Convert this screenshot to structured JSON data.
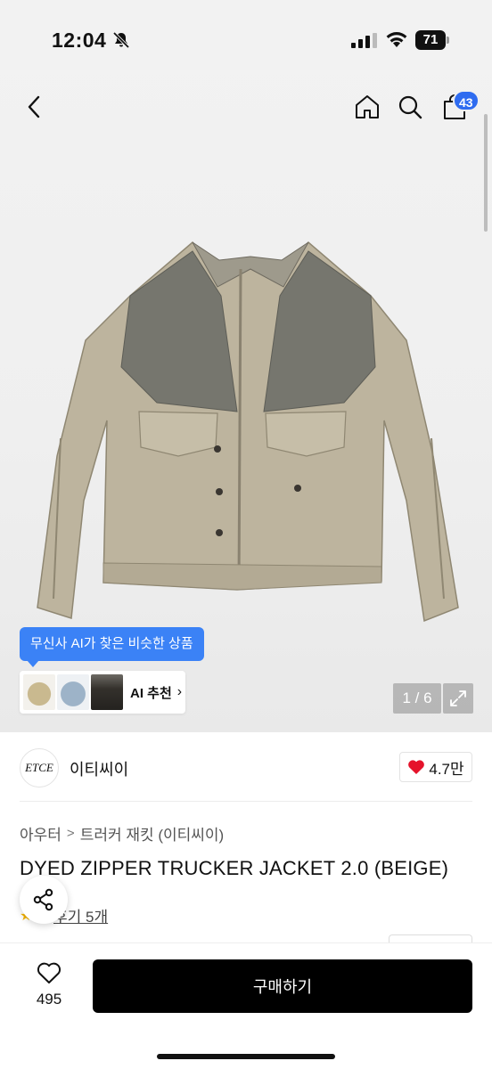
{
  "status": {
    "time": "12:04",
    "battery": "71"
  },
  "header": {
    "cart_count": "43"
  },
  "gallery": {
    "counter": "1 / 6"
  },
  "ai": {
    "tooltip": "무신사 AI가 찾은 비슷한 상품",
    "rec_label": "AI 추천"
  },
  "brand": {
    "logo_text": "ETCE",
    "name": "이티씨이",
    "likes": "4.7만"
  },
  "product": {
    "breadcrumb": [
      "아우터",
      "트러커 재킷 (이티씨이)"
    ],
    "title": "DYED ZIPPER TRUCKER JACKET 2.0 (BEIGE)",
    "review_link": "후기 5개"
  },
  "bottom": {
    "wish_count": "495",
    "buy_label": "구매하기"
  },
  "colors": {
    "accent_blue": "#3b82f6",
    "badge_blue": "#2f6cf0",
    "heart_red": "#e5132b",
    "buy_black": "#000000"
  }
}
